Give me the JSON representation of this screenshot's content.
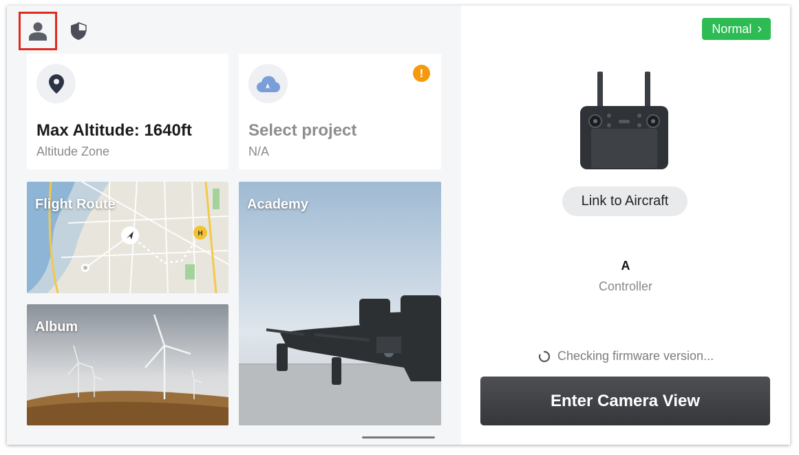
{
  "header": {
    "icons": [
      "user-icon",
      "shield-icon"
    ]
  },
  "cards": {
    "altitude": {
      "title": "Max Altitude: 1640ft",
      "subtitle": "Altitude Zone",
      "icon": "location-pin-icon"
    },
    "project": {
      "title": "Select project",
      "subtitle": "N/A",
      "icon": "cloud-icon",
      "badge": "!"
    }
  },
  "tiles": {
    "flight_route": {
      "label": "Flight Route"
    },
    "album": {
      "label": "Album"
    },
    "academy": {
      "label": "Academy"
    }
  },
  "right_panel": {
    "mode_label": "Normal",
    "mode_chevron": "›",
    "link_button": "Link to Aircraft",
    "device_name": "A",
    "device_type": "Controller",
    "firmware_status": "Checking firmware version...",
    "camera_button": "Enter Camera View"
  },
  "colors": {
    "mode_green": "#2dbb54",
    "warning_orange": "#f59a0c",
    "highlight_red": "#e0291e"
  }
}
